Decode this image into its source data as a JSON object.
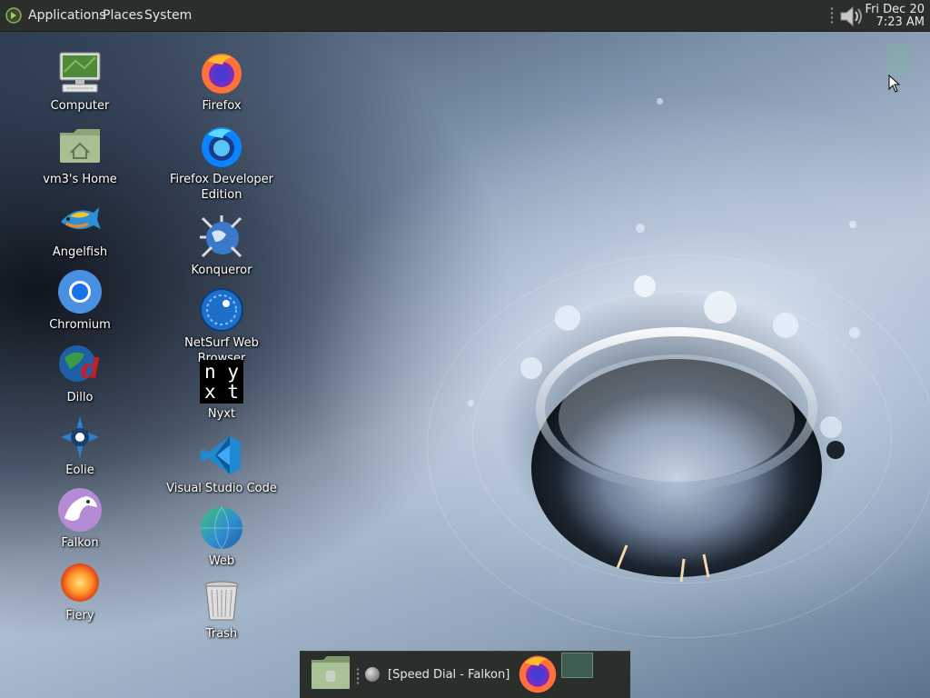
{
  "top_panel": {
    "menus": [
      "Applications",
      "Places",
      "System"
    ],
    "clock": {
      "date": "Fri Dec 20",
      "time": "7:23 AM"
    },
    "icons": {
      "menu_logo": "gnome-foot-icon",
      "volume": "speaker-volume-icon"
    }
  },
  "desktop": {
    "icons": [
      {
        "label": "Computer",
        "icon": "computer-monitor-icon"
      },
      {
        "label": "vm3's Home",
        "icon": "home-folder-icon"
      },
      {
        "label": "Angelfish",
        "icon": "angelfish-browser-icon"
      },
      {
        "label": "Chromium",
        "icon": "chromium-icon"
      },
      {
        "label": "Dillo",
        "icon": "dillo-icon"
      },
      {
        "label": "Eolie",
        "icon": "eolie-icon"
      },
      {
        "label": "Falkon",
        "icon": "falkon-icon"
      },
      {
        "label": "Fiery",
        "icon": "fiery-icon"
      },
      {
        "label": "Firefox",
        "icon": "firefox-icon"
      },
      {
        "label": "Firefox Developer\nEdition",
        "icon": "firefox-developer-icon"
      },
      {
        "label": "Konqueror",
        "icon": "konqueror-icon"
      },
      {
        "label": "NetSurf Web Browser",
        "icon": "netsurf-icon"
      },
      {
        "label": "Nyxt",
        "icon": "nyxt-icon",
        "glyph_lines": [
          "n y",
          "x t"
        ]
      },
      {
        "label": "Visual Studio Code",
        "icon": "vscode-icon"
      },
      {
        "label": "Web",
        "icon": "gnome-web-icon"
      },
      {
        "label": "Trash",
        "icon": "trash-icon"
      }
    ]
  },
  "bottom_panel": {
    "show_desktop_icon": "show-desktop-folder-icon",
    "window_button": {
      "label": "[Speed Dial - Falkon]",
      "icon": "globe-icon"
    },
    "launcher_icon": "firefox-icon",
    "workspace_pager": "workspace-pager"
  },
  "colors": {
    "panel_bg": "#2b2f2b",
    "panel_text": "#e6e6e6",
    "desktop_label": "#ffffff"
  }
}
